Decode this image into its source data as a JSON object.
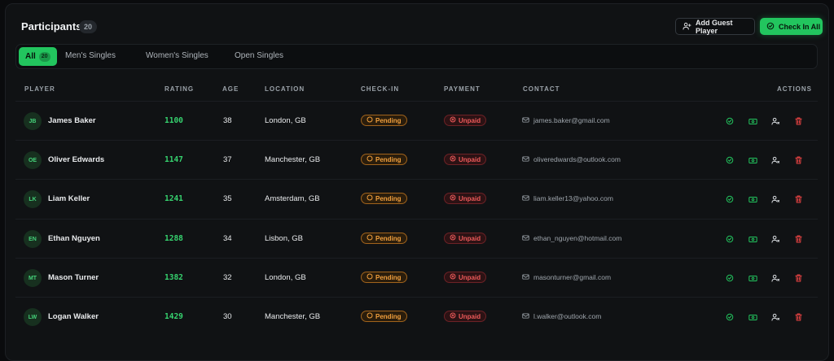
{
  "header": {
    "title": "Participants",
    "count": "20",
    "add_guest_label": "Add Guest Player",
    "check_in_all_label": "Check In All"
  },
  "tabs": [
    {
      "label": "All",
      "badge": "20",
      "active": true
    },
    {
      "label": "Men's Singles"
    },
    {
      "label": "Women's Singles"
    },
    {
      "label": "Open Singles"
    }
  ],
  "columns": [
    "PLAYER",
    "RATING",
    "AGE",
    "LOCATION",
    "CHECK-IN",
    "PAYMENT",
    "CONTACT",
    "ACTIONS"
  ],
  "rows": [
    {
      "initials": "JB",
      "name": "James Baker",
      "rating": "1100",
      "age": "38",
      "location": "London, GB",
      "checkin": "Pending",
      "payment": "Unpaid",
      "email": "james.baker@gmail.com"
    },
    {
      "initials": "OE",
      "name": "Oliver Edwards",
      "rating": "1147",
      "age": "37",
      "location": "Manchester, GB",
      "checkin": "Pending",
      "payment": "Unpaid",
      "email": "oliveredwards@outlook.com"
    },
    {
      "initials": "LK",
      "name": "Liam Keller",
      "rating": "1241",
      "age": "35",
      "location": "Amsterdam, GB",
      "checkin": "Pending",
      "payment": "Unpaid",
      "email": "liam.keller13@yahoo.com"
    },
    {
      "initials": "EN",
      "name": "Ethan Nguyen",
      "rating": "1288",
      "age": "34",
      "location": "Lisbon, GB",
      "checkin": "Pending",
      "payment": "Unpaid",
      "email": "ethan_nguyen@hotmail.com"
    },
    {
      "initials": "MT",
      "name": "Mason Turner",
      "rating": "1382",
      "age": "32",
      "location": "London, GB",
      "checkin": "Pending",
      "payment": "Unpaid",
      "email": "masonturner@gmail.com"
    },
    {
      "initials": "LW",
      "name": "Logan Walker",
      "rating": "1429",
      "age": "30",
      "location": "Manchester, GB",
      "checkin": "Pending",
      "payment": "Unpaid",
      "email": "l.walker@outlook.com"
    }
  ],
  "icons": {
    "row_actions": [
      "check-circle-icon",
      "cash-icon",
      "user-edit-icon",
      "trash-icon"
    ],
    "checkin": "pending-circle-icon",
    "payment": "x-circle-icon",
    "contact": "mail-icon"
  },
  "colors": {
    "accent": "#22c55e",
    "pending": "#f2a03d",
    "unpaid": "#ef5a5a",
    "background": "#0a0b0d"
  }
}
